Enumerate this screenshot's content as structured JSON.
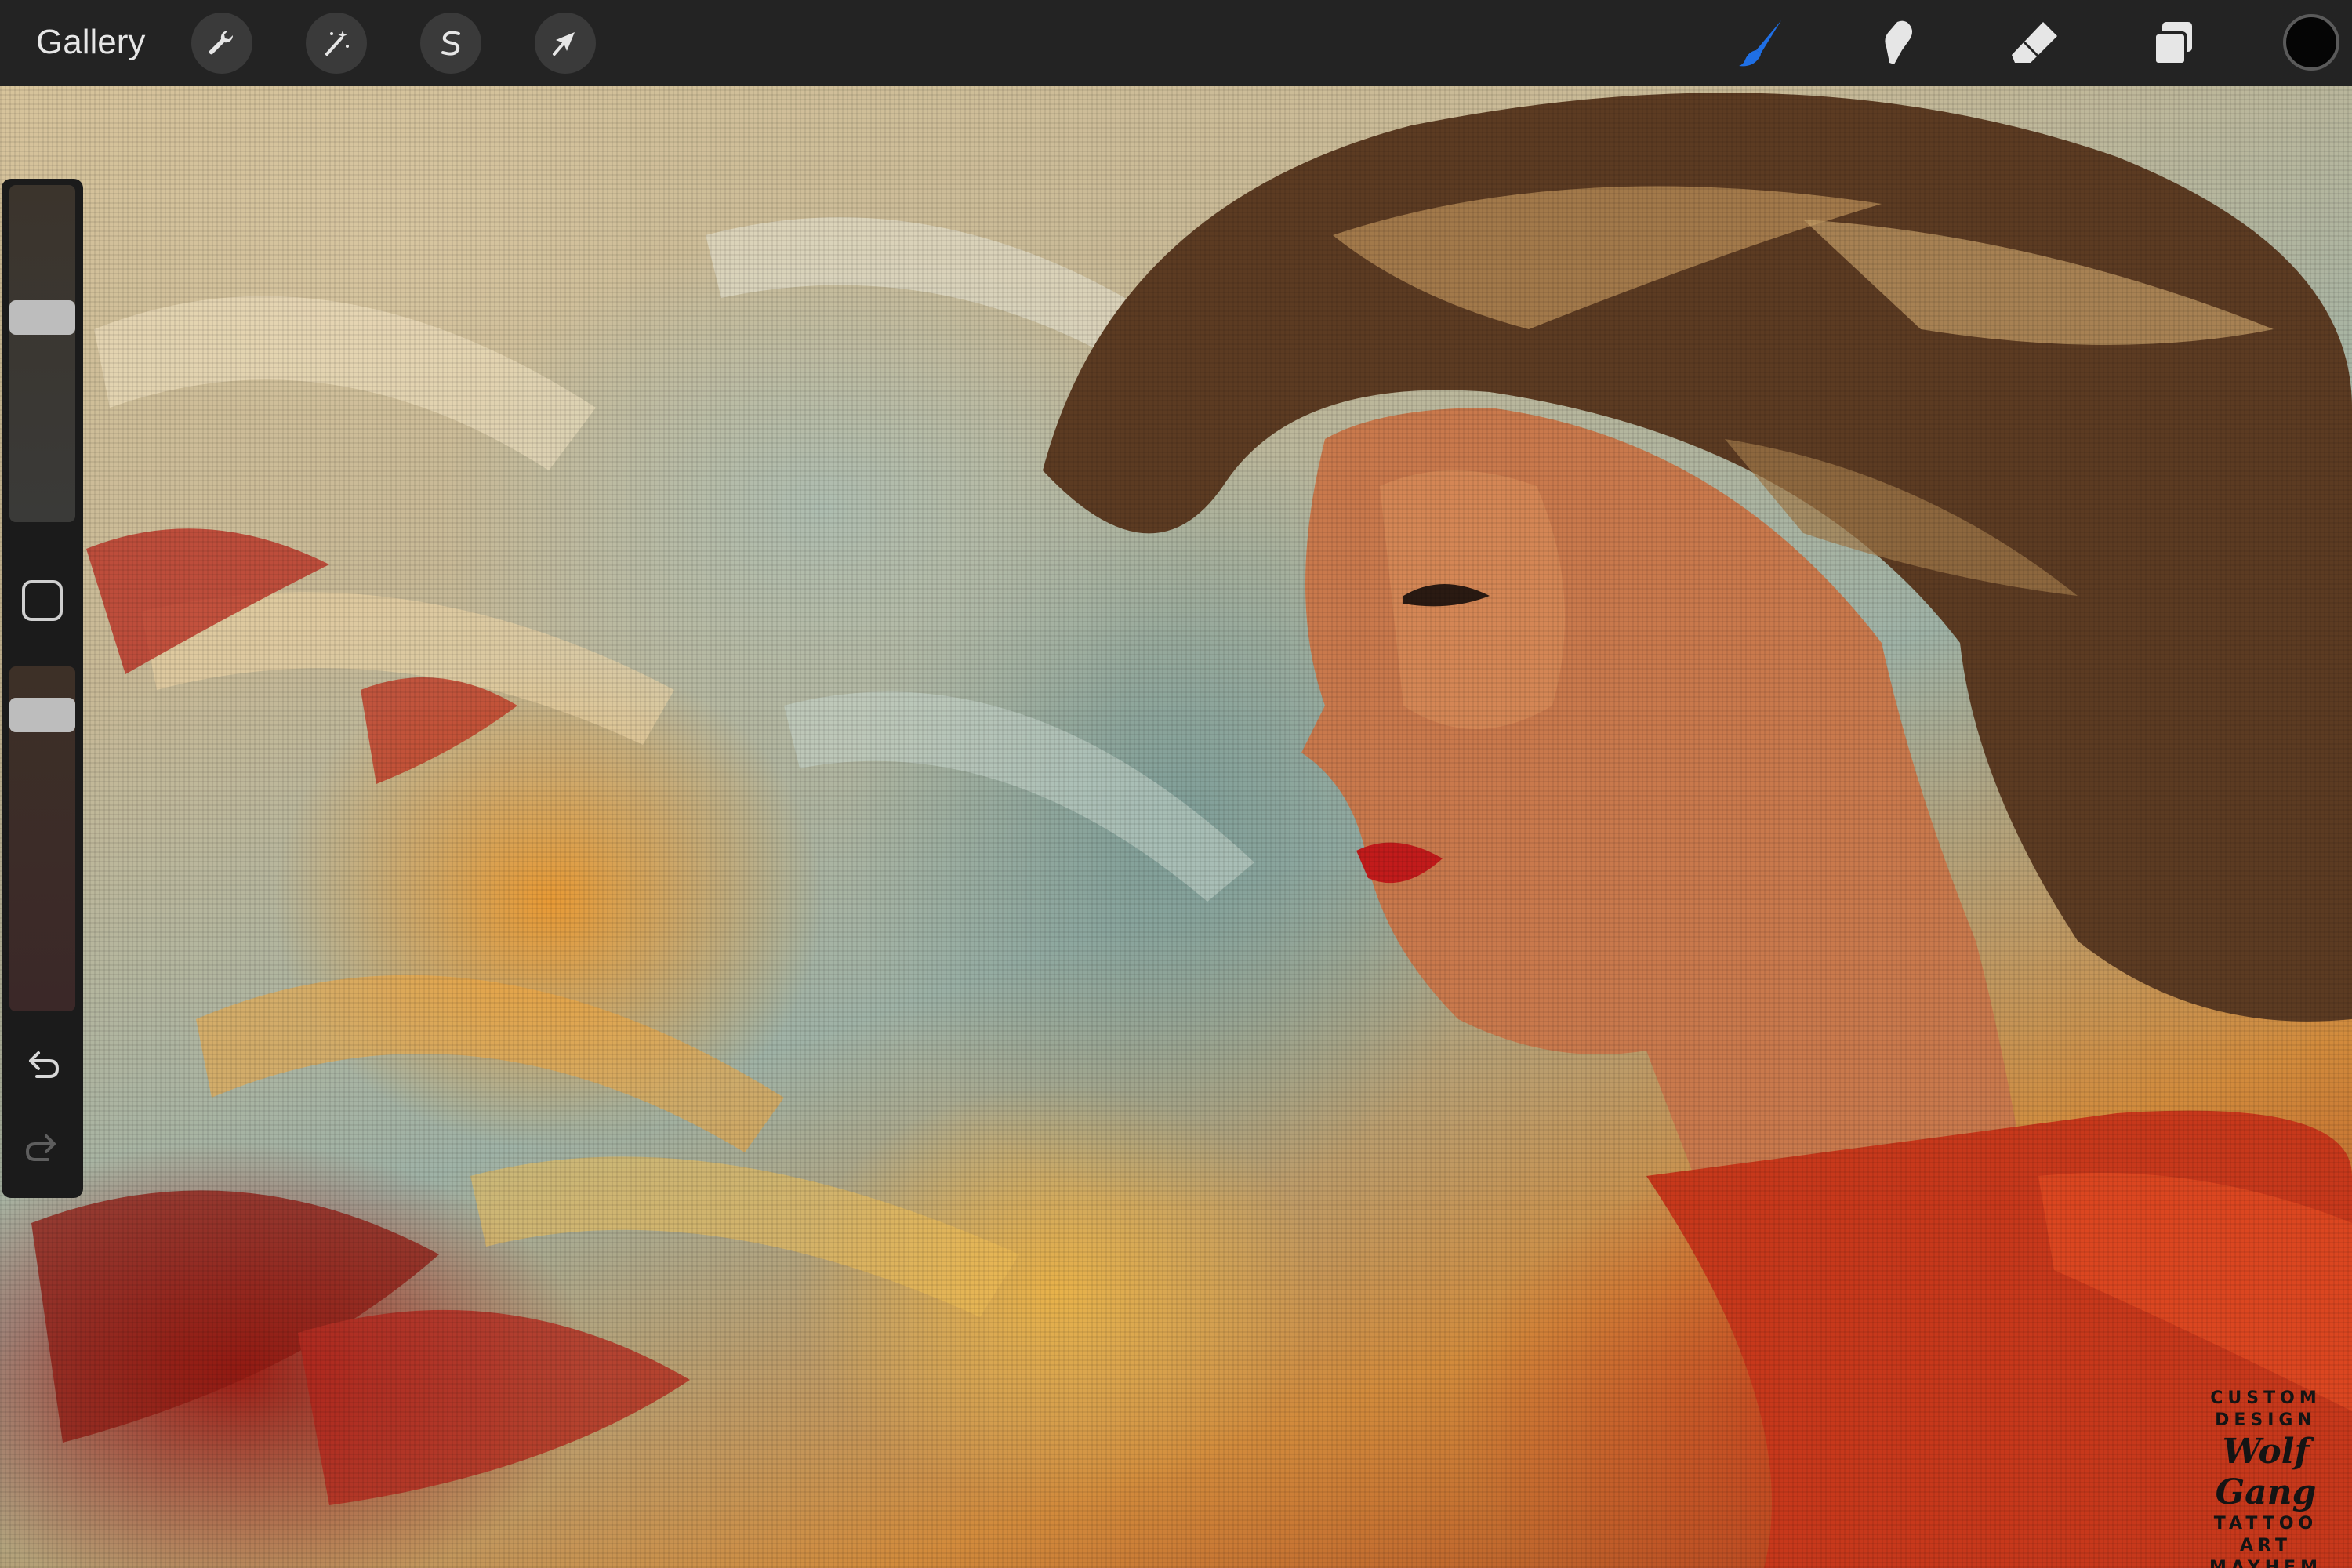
{
  "toolbar": {
    "gallery_label": "Gallery",
    "left_tools": [
      {
        "name": "actions",
        "icon": "wrench-icon"
      },
      {
        "name": "adjustments",
        "icon": "magic-wand-icon"
      },
      {
        "name": "selection",
        "icon": "selection-s-icon"
      },
      {
        "name": "transform",
        "icon": "arrow-cursor-icon"
      }
    ],
    "right_tools": [
      {
        "name": "brush",
        "icon": "brush-icon",
        "active": true
      },
      {
        "name": "smudge",
        "icon": "smudge-icon",
        "active": false
      },
      {
        "name": "eraser",
        "icon": "eraser-icon",
        "active": false
      },
      {
        "name": "layers",
        "icon": "layers-icon",
        "active": false
      }
    ],
    "active_color": "#050505",
    "accent_color": "#1f6fe5"
  },
  "sidebar": {
    "brush_size_level": 0.62,
    "brush_opacity_level": 0.9,
    "modify_icon": "square-icon",
    "undo_icon": "undo-icon",
    "redo_icon": "redo-icon"
  },
  "watermark": {
    "line1": "CUSTOM",
    "line2": "DESIGN",
    "script": "Wolf Gang",
    "line3": "TATTOO ART",
    "line4": "MAYHEM"
  }
}
